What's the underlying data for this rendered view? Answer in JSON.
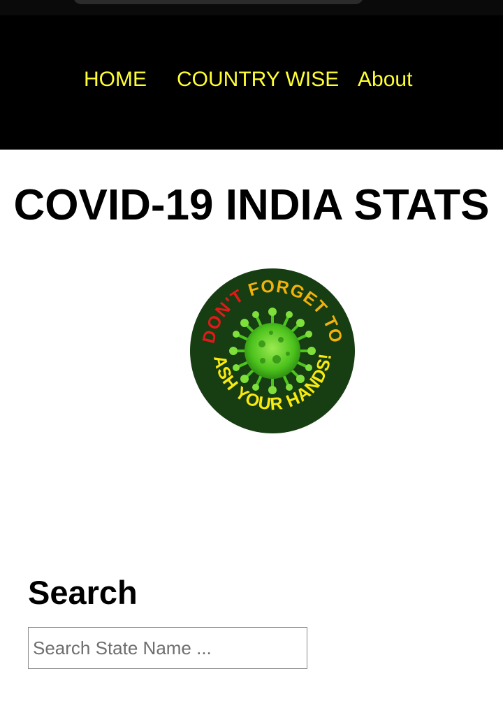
{
  "nav": {
    "items": [
      {
        "label": "HOME"
      },
      {
        "label": "COUNTRY WISE"
      },
      {
        "label": "About"
      }
    ]
  },
  "page": {
    "title": "COVID-19 INDIA STATS"
  },
  "badge": {
    "top_text_red": "DON'T",
    "top_text_orange": "FORGET TO",
    "bottom_text": "WASH YOUR HANDS!!!",
    "colors": {
      "background": "#173d12",
      "red": "#e01a1a",
      "orange": "#f2b20b",
      "yellow": "#f7ea10",
      "virus": "#5fd12a"
    }
  },
  "search": {
    "heading": "Search",
    "placeholder": "Search State Name ...",
    "value": ""
  },
  "colors": {
    "nav_background": "#000000",
    "nav_text": "#ffff33"
  }
}
